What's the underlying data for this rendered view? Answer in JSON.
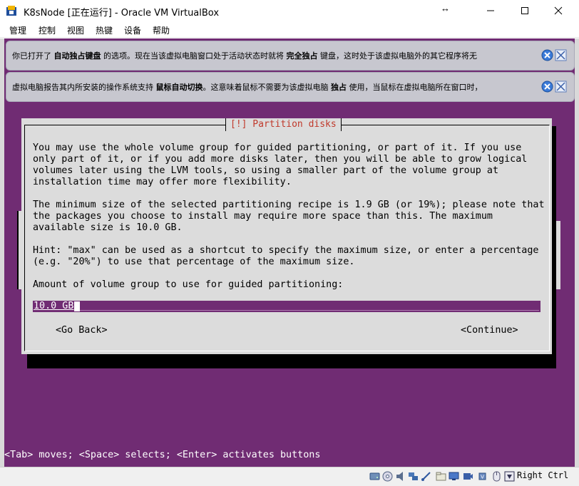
{
  "window": {
    "title": "K8sNode [正在运行] - Oracle VM VirtualBox",
    "resize_glyph": "↔",
    "minimize_icon": "minimize-icon",
    "maximize_icon": "maximize-icon",
    "close_icon": "close-icon"
  },
  "menu": [
    "管理",
    "控制",
    "视图",
    "热键",
    "设备",
    "帮助"
  ],
  "notices": [
    {
      "pre": "你已打开了 ",
      "bold1": "自动独占键盘",
      "mid": " 的选项。现在当该虚拟电脑窗口处于活动状态时就将 ",
      "bold2": "完全独占",
      "post": " 键盘，这时处于该虚拟电脑外的其它程序将无"
    },
    {
      "pre": "虚拟电脑报告其内所安装的操作系统支持 ",
      "bold1": "鼠标自动切换",
      "mid": "。这意味着鼠标不需要为该虚拟电脑 ",
      "bold2": "独占",
      "post": " 使用，当鼠标在虚拟电脑所在窗口时，"
    }
  ],
  "dialog": {
    "title": "[!] Partition disks",
    "paragraph1": [
      "You may use the whole volume group for guided partitioning, or part of it. If you use",
      "only part of it, or if you add more disks later, then you will be able to grow logical",
      "volumes later using the LVM tools, so using a smaller part of the volume group at",
      "installation time may offer more flexibility."
    ],
    "paragraph2": [
      "The minimum size of the selected partitioning recipe is 1.9 GB (or 19%); please note that",
      "the packages you choose to install may require more space than this. The maximum",
      "available size is 10.0 GB."
    ],
    "paragraph3": [
      "Hint: \"max\" can be used as a shortcut to specify the maximum size, or enter a percentage",
      "(e.g. \"20%\") to use that percentage of the maximum size."
    ],
    "prompt": "Amount of volume group to use for guided partitioning:",
    "input_value": "10.0 GB",
    "go_back": "<Go Back>",
    "continue": "<Continue>"
  },
  "helpline": "<Tab> moves; <Space> selects; <Enter> activates buttons",
  "status": {
    "host_key": "Right Ctrl",
    "icons": [
      "hard-disk-icon",
      "optical-drive-icon",
      "audio-icon",
      "network-icon",
      "usb-icon",
      "shared-folders-icon",
      "display-icon",
      "video-capture-icon",
      "cpu-icon",
      "mouse-integration-icon",
      "keyboard-capture-icon"
    ]
  },
  "colors": {
    "console_bg": "#702c73",
    "dialog_bg": "#dcdcdc",
    "dialog_title": "#c0392b",
    "notice_bg": "#c7c7cf"
  }
}
